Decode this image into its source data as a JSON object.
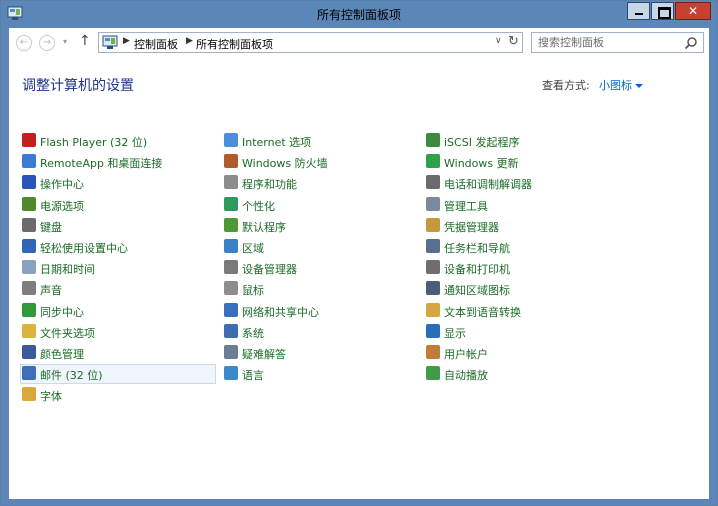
{
  "window": {
    "title": "所有控制面板项",
    "close_glyph": "✕"
  },
  "navbar": {
    "back_glyph": "←",
    "forward_glyph": "→",
    "recent_glyph": "▾",
    "up_glyph": "↑",
    "breadcrumb": [
      "控制面板",
      "所有控制面板项"
    ],
    "breadcrumb_separator": "▶",
    "address_dropdown_glyph": "∨",
    "refresh_glyph": "↻",
    "search_placeholder": "搜索控制面板"
  },
  "content": {
    "heading": "调整计算机的设置",
    "view_by_label": "查看方式:",
    "view_by_value": "小图标"
  },
  "columns": [
    [
      {
        "label": "Flash Player (32 位)",
        "icon": "flash-player-icon",
        "color": "#c41f1f"
      },
      {
        "label": "RemoteApp 和桌面连接",
        "icon": "remoteapp-icon",
        "color": "#3a7bd5"
      },
      {
        "label": "操作中心",
        "icon": "action-center-flag-icon",
        "color": "#2a55b8"
      },
      {
        "label": "电源选项",
        "icon": "power-options-icon",
        "color": "#4f8a2a"
      },
      {
        "label": "键盘",
        "icon": "keyboard-icon",
        "color": "#6b6b6b"
      },
      {
        "label": "轻松使用设置中心",
        "icon": "ease-of-access-icon",
        "color": "#2f66b5"
      },
      {
        "label": "日期和时间",
        "icon": "date-time-icon",
        "color": "#8aa2bf"
      },
      {
        "label": "声音",
        "icon": "sound-icon",
        "color": "#7d7d7d"
      },
      {
        "label": "同步中心",
        "icon": "sync-center-icon",
        "color": "#2f9a3a"
      },
      {
        "label": "文件夹选项",
        "icon": "folder-options-icon",
        "color": "#d9b441"
      },
      {
        "label": "颜色管理",
        "icon": "color-management-icon",
        "color": "#3c5a9a"
      },
      {
        "label": "邮件 (32 位)",
        "icon": "mail-icon",
        "color": "#3b6fb6"
      },
      {
        "label": "字体",
        "icon": "fonts-icon",
        "color": "#d8a93a"
      }
    ],
    [
      {
        "label": "Internet 选项",
        "icon": "internet-options-icon",
        "color": "#4a8fd8"
      },
      {
        "label": "Windows 防火墙",
        "icon": "firewall-icon",
        "color": "#b25b2a"
      },
      {
        "label": "程序和功能",
        "icon": "programs-features-icon",
        "color": "#8c8c8c"
      },
      {
        "label": "个性化",
        "icon": "personalization-icon",
        "color": "#2e9b5c"
      },
      {
        "label": "默认程序",
        "icon": "default-programs-icon",
        "color": "#4c9a36"
      },
      {
        "label": "区域",
        "icon": "region-icon",
        "color": "#3a82c8"
      },
      {
        "label": "设备管理器",
        "icon": "device-manager-icon",
        "color": "#7a7a7a"
      },
      {
        "label": "鼠标",
        "icon": "mouse-icon",
        "color": "#8d8d8d"
      },
      {
        "label": "网络和共享中心",
        "icon": "network-sharing-icon",
        "color": "#3a6fc0"
      },
      {
        "label": "系统",
        "icon": "system-icon",
        "color": "#3c6db0"
      },
      {
        "label": "疑难解答",
        "icon": "troubleshooting-icon",
        "color": "#6c7c94"
      },
      {
        "label": "语言",
        "icon": "language-icon",
        "color": "#3a8acb"
      }
    ],
    [
      {
        "label": "iSCSI 发起程序",
        "icon": "iscsi-icon",
        "color": "#3e8a3e"
      },
      {
        "label": "Windows 更新",
        "icon": "windows-update-icon",
        "color": "#2fa14a"
      },
      {
        "label": "电话和调制解调器",
        "icon": "phone-modem-icon",
        "color": "#6b6b6b"
      },
      {
        "label": "管理工具",
        "icon": "administrative-tools-icon",
        "color": "#7e8a9c"
      },
      {
        "label": "凭据管理器",
        "icon": "credential-manager-icon",
        "color": "#c59a3d"
      },
      {
        "label": "任务栏和导航",
        "icon": "taskbar-navigation-icon",
        "color": "#5a6f8f"
      },
      {
        "label": "设备和打印机",
        "icon": "devices-printers-icon",
        "color": "#6e6e6e"
      },
      {
        "label": "通知区域图标",
        "icon": "notification-area-icon",
        "color": "#4a5e7a"
      },
      {
        "label": "文本到语音转换",
        "icon": "text-to-speech-icon",
        "color": "#d6a640"
      },
      {
        "label": "显示",
        "icon": "display-icon",
        "color": "#2b6cb8"
      },
      {
        "label": "用户帐户",
        "icon": "user-accounts-icon",
        "color": "#c17c3c"
      },
      {
        "label": "自动播放",
        "icon": "autoplay-icon",
        "color": "#3f9a4a"
      }
    ]
  ]
}
